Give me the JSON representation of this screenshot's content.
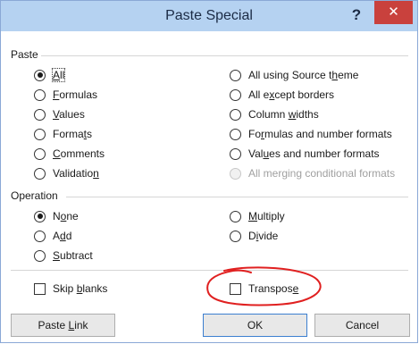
{
  "window": {
    "title": "Paste Special",
    "help_glyph": "?",
    "close_glyph": "✕"
  },
  "paste": {
    "label": "Paste",
    "options_left": [
      {
        "pre": "",
        "key": "A",
        "post": "ll",
        "checked": true,
        "disabled": false
      },
      {
        "pre": "",
        "key": "F",
        "post": "ormulas",
        "checked": false,
        "disabled": false
      },
      {
        "pre": "",
        "key": "V",
        "post": "alues",
        "checked": false,
        "disabled": false
      },
      {
        "pre": "Forma",
        "key": "t",
        "post": "s",
        "checked": false,
        "disabled": false
      },
      {
        "pre": "",
        "key": "C",
        "post": "omments",
        "checked": false,
        "disabled": false
      },
      {
        "pre": "Validatio",
        "key": "n",
        "post": "",
        "checked": false,
        "disabled": false
      }
    ],
    "options_right": [
      {
        "pre": "All using Source t",
        "key": "h",
        "post": "eme",
        "checked": false,
        "disabled": false
      },
      {
        "pre": "All e",
        "key": "x",
        "post": "cept borders",
        "checked": false,
        "disabled": false
      },
      {
        "pre": "Column ",
        "key": "w",
        "post": "idths",
        "checked": false,
        "disabled": false
      },
      {
        "pre": "Fo",
        "key": "r",
        "post": "mulas and number formats",
        "checked": false,
        "disabled": false
      },
      {
        "pre": "Val",
        "key": "u",
        "post": "es and number formats",
        "checked": false,
        "disabled": false
      },
      {
        "pre": "All merging conditional formats",
        "key": "",
        "post": "",
        "checked": false,
        "disabled": true
      }
    ]
  },
  "operation": {
    "label": "Operation",
    "options_left": [
      {
        "pre": "N",
        "key": "o",
        "post": "ne",
        "checked": true
      },
      {
        "pre": "A",
        "key": "d",
        "post": "d",
        "checked": false
      },
      {
        "pre": "",
        "key": "S",
        "post": "ubtract",
        "checked": false
      }
    ],
    "options_right": [
      {
        "pre": "",
        "key": "M",
        "post": "ultiply",
        "checked": false
      },
      {
        "pre": "D",
        "key": "i",
        "post": "vide",
        "checked": false
      }
    ]
  },
  "checkboxes": {
    "skip_blanks": {
      "pre": "Skip ",
      "key": "b",
      "post": "lanks",
      "checked": false
    },
    "transpose": {
      "pre": "Transpos",
      "key": "e",
      "post": "",
      "checked": false
    }
  },
  "buttons": {
    "paste_link": {
      "pre": "Paste ",
      "key": "L",
      "post": "ink"
    },
    "ok": {
      "pre": "OK",
      "key": "",
      "post": ""
    },
    "cancel": {
      "pre": "Cancel",
      "key": "",
      "post": ""
    }
  },
  "colors": {
    "titlebar": "#b5d2f1",
    "close": "#c9413d",
    "annotation": "#e02020"
  }
}
